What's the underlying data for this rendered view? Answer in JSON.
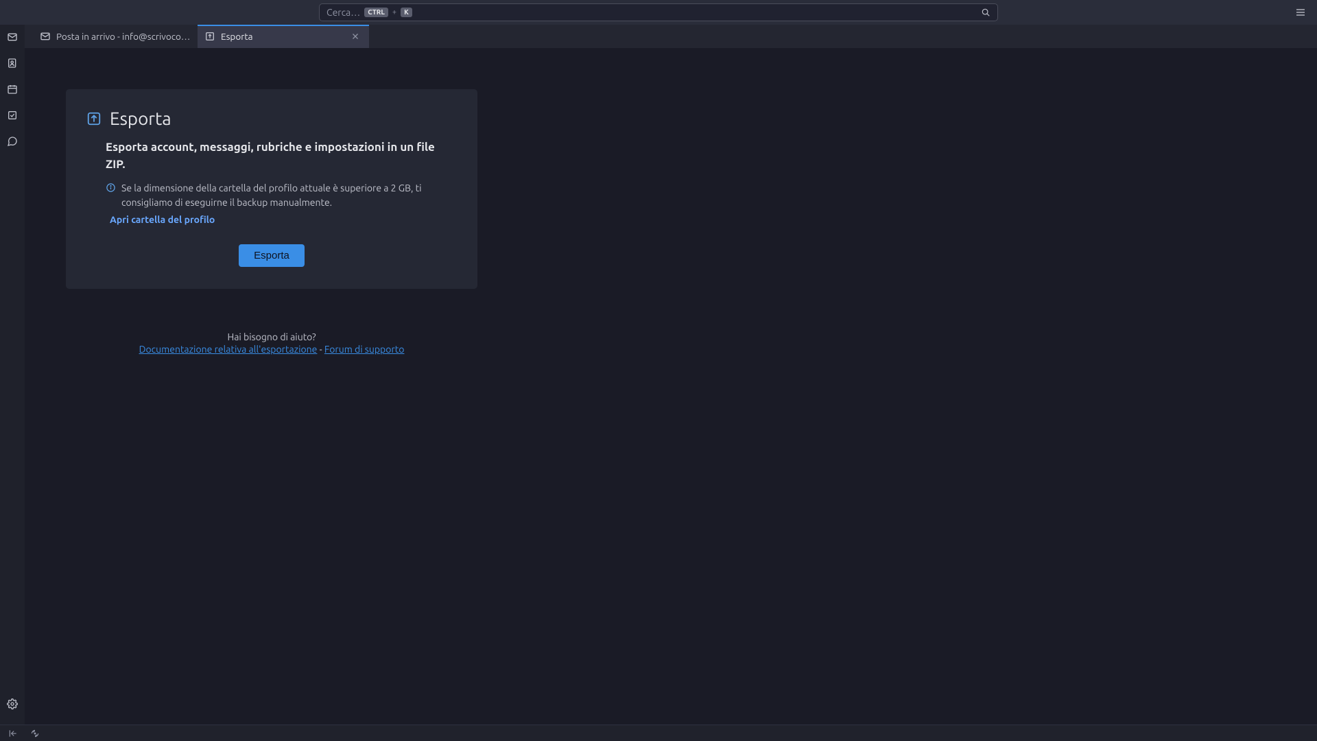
{
  "titlebar": {
    "search_placeholder": "Cerca…",
    "kbd_ctrl": "CTRL",
    "kbd_plus": "+",
    "kbd_k": "K"
  },
  "tabs": [
    {
      "label": "Posta in arrivo - info@scrivocodice",
      "active": false
    },
    {
      "label": "Esporta",
      "active": true
    }
  ],
  "export_panel": {
    "title": "Esporta",
    "subtitle": "Esporta account, messaggi, rubriche e impostazioni in un file ZIP.",
    "info_text": "Se la dimensione della cartella del profilo attuale è superiore a 2 GB, ti consigliamo di eseguirne il backup manualmente.",
    "open_profile_link": "Apri cartella del profilo",
    "export_button": "Esporta"
  },
  "help": {
    "question": "Hai bisogno di aiuto?",
    "doc_link": "Documentazione relativa all'esportazione",
    "separator": " - ",
    "forum_link": "Forum di supporto"
  }
}
